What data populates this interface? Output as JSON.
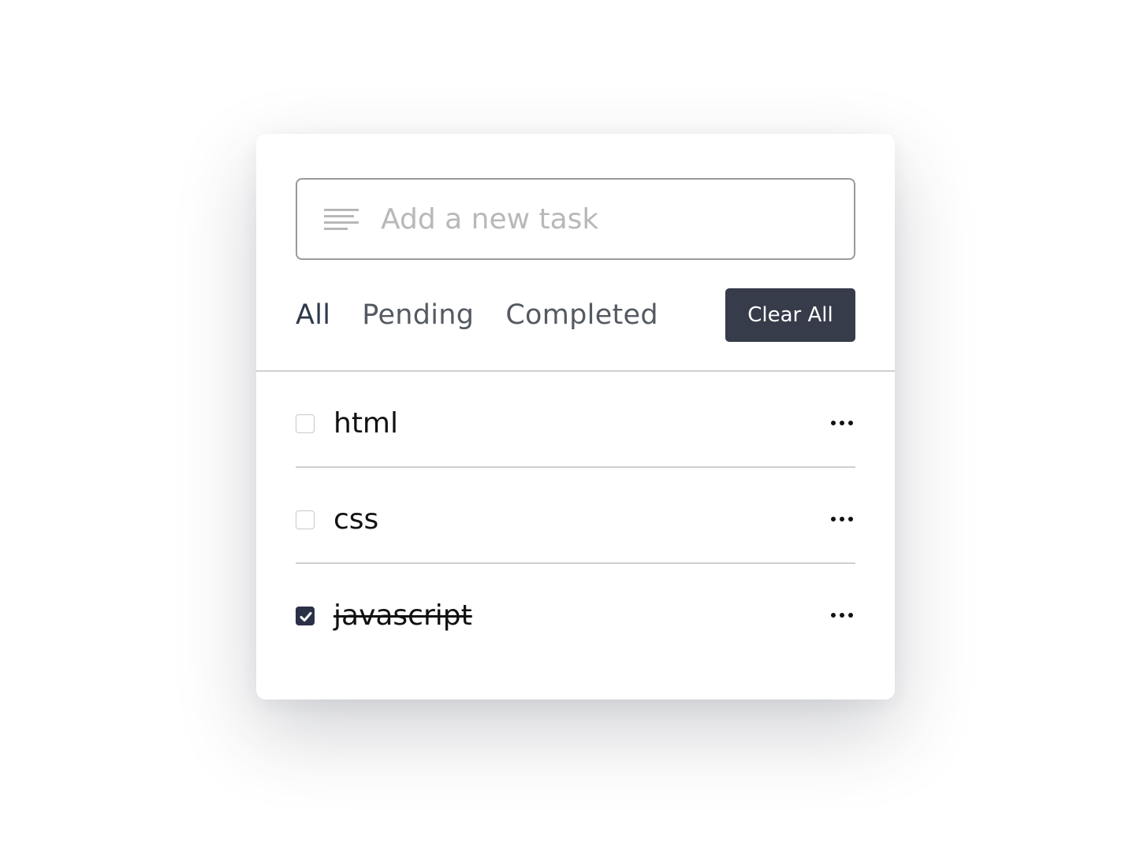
{
  "input": {
    "placeholder": "Add a new task",
    "value": "",
    "icon": "text-lines-icon"
  },
  "filters": [
    {
      "label": "All",
      "active": true
    },
    {
      "label": "Pending",
      "active": false
    },
    {
      "label": "Completed",
      "active": false
    }
  ],
  "clear_button": {
    "label": "Clear All"
  },
  "tasks": [
    {
      "label": "html",
      "completed": false,
      "menu_icon": "more-horizontal-icon"
    },
    {
      "label": "css",
      "completed": false,
      "menu_icon": "more-horizontal-icon"
    },
    {
      "label": "javascript",
      "completed": true,
      "menu_icon": "more-horizontal-icon"
    }
  ],
  "colors": {
    "accent": "#363c4a",
    "checkbox_checked": "#2a3147",
    "active_filter": "#2f3a4d",
    "divider": "#cfcfcf"
  }
}
